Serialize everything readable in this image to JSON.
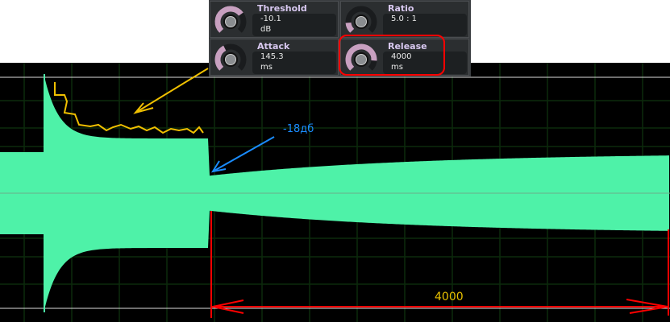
{
  "plugin": {
    "threshold": {
      "label": "Threshold",
      "value": "-10.1",
      "unit": "dB",
      "level": 0.7
    },
    "ratio": {
      "label": "Ratio",
      "value": "5.0 : 1",
      "unit": "",
      "level": 0.15
    },
    "attack": {
      "label": "Attack",
      "value": "145.3",
      "unit": "ms",
      "level": 0.4
    },
    "release": {
      "label": "Release",
      "value": "4000",
      "unit": "ms",
      "level": 0.85
    }
  },
  "annotations": {
    "gain_drop": "-18дб",
    "release_span": "4000"
  },
  "colors": {
    "waveform": "#4ef2a8",
    "grid": "#0c2a0c",
    "annotation_red": "#ff0000",
    "annotation_yellow": "#f0c000",
    "annotation_blue": "#1a8cff",
    "title": "#d8c8f0"
  }
}
